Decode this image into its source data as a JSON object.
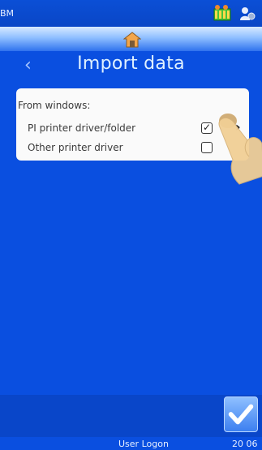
{
  "status_bar": {
    "left_text": "BM"
  },
  "header": {
    "back_label": "‹",
    "title": "Import data"
  },
  "card": {
    "section_label": "From windows:",
    "rows": [
      {
        "label": "PI printer driver/folder",
        "checked": true,
        "check_glyph": "✓",
        "chevron": "›"
      },
      {
        "label": "Other printer driver",
        "checked": false
      }
    ]
  },
  "footer": {
    "user": "User Logon",
    "time": "20 06"
  },
  "colors": {
    "background": "#0a4fe0",
    "title": "#dff1ff",
    "card": "#fafafa"
  }
}
